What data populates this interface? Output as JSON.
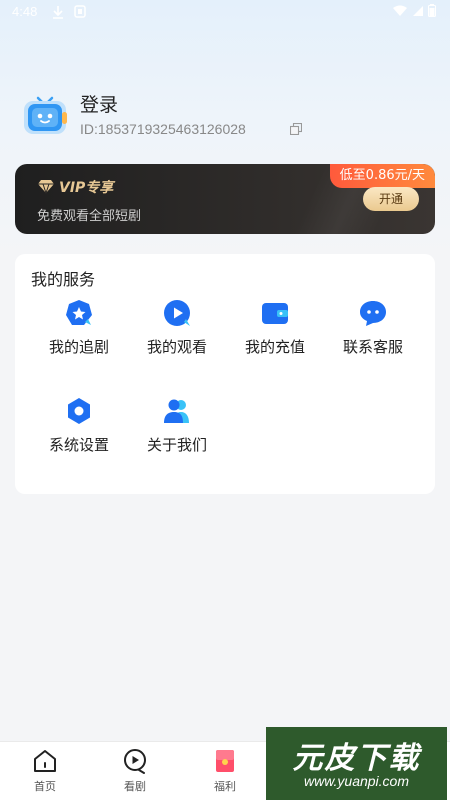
{
  "status_bar": {
    "time": "4:48"
  },
  "profile": {
    "login_label": "登录",
    "user_id": "ID:1853719325463126028"
  },
  "vip": {
    "title": "VIP专享",
    "subtitle": "免费观看全部短剧",
    "price_badge": "低至0.86元/天",
    "open_button": "开通"
  },
  "services": {
    "title": "我的服务",
    "items": [
      {
        "label": "我的追剧",
        "icon": "star-icon"
      },
      {
        "label": "我的观看",
        "icon": "play-icon"
      },
      {
        "label": "我的充值",
        "icon": "wallet-icon"
      },
      {
        "label": "联系客服",
        "icon": "chat-icon"
      },
      {
        "label": "系统设置",
        "icon": "settings-icon"
      },
      {
        "label": "关于我们",
        "icon": "people-icon"
      }
    ]
  },
  "tabbar": {
    "items": [
      {
        "label": "首页",
        "icon": "home-icon"
      },
      {
        "label": "看剧",
        "icon": "play-circle-icon"
      },
      {
        "label": "福利",
        "icon": "gift-icon"
      }
    ]
  },
  "watermark": {
    "title": "元皮下载",
    "url": "www.yuanpi.com"
  },
  "colors": {
    "accent": "#1f6ff2",
    "vip_gold": "#e7c895",
    "price_badge": "#ff5a3c"
  }
}
